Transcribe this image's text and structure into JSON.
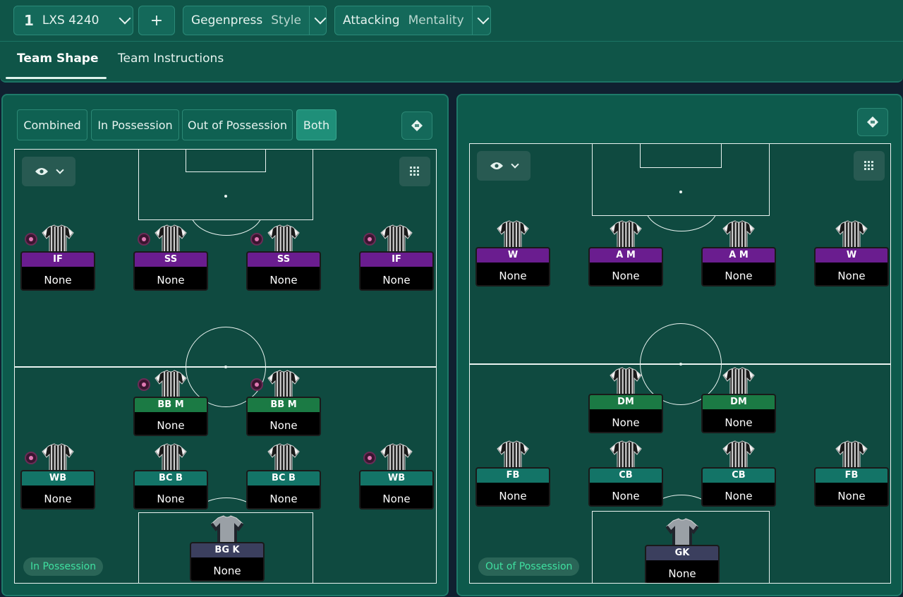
{
  "tactic": {
    "number": "1",
    "name": "LXS 4240"
  },
  "add_label": "+",
  "style": {
    "value": "Gegenpress",
    "label": "Style"
  },
  "mentality": {
    "value": "Attacking",
    "label": "Mentality"
  },
  "tabs": [
    "Team Shape",
    "Team Instructions"
  ],
  "view_toggles": [
    "Combined",
    "In Possession",
    "Out of Possession",
    "Both"
  ],
  "active_view": "Both",
  "left": {
    "legend": "In Possession",
    "players": [
      {
        "role": "IF",
        "duty": "None",
        "color": "purple",
        "token": true
      },
      {
        "role": "SS",
        "duty": "None",
        "color": "purple",
        "token": true
      },
      {
        "role": "SS",
        "duty": "None",
        "color": "purple",
        "token": true
      },
      {
        "role": "IF",
        "duty": "None",
        "color": "purple",
        "token": true
      },
      {
        "role": "BB M",
        "duty": "None",
        "color": "green",
        "token": true
      },
      {
        "role": "BB M",
        "duty": "None",
        "color": "green",
        "token": true
      },
      {
        "role": "WB",
        "duty": "None",
        "color": "teal",
        "token": true
      },
      {
        "role": "BC B",
        "duty": "None",
        "color": "teal",
        "token": false
      },
      {
        "role": "BC B",
        "duty": "None",
        "color": "teal",
        "token": false
      },
      {
        "role": "WB",
        "duty": "None",
        "color": "teal",
        "token": true
      },
      {
        "role": "BG K",
        "duty": "None",
        "color": "gk",
        "token": false
      }
    ]
  },
  "right": {
    "legend": "Out of Possession",
    "players": [
      {
        "role": "W",
        "duty": "None",
        "color": "purple"
      },
      {
        "role": "A M",
        "duty": "None",
        "color": "purple"
      },
      {
        "role": "A M",
        "duty": "None",
        "color": "purple"
      },
      {
        "role": "W",
        "duty": "None",
        "color": "purple"
      },
      {
        "role": "DM",
        "duty": "None",
        "color": "green"
      },
      {
        "role": "DM",
        "duty": "None",
        "color": "green"
      },
      {
        "role": "FB",
        "duty": "None",
        "color": "teal"
      },
      {
        "role": "CB",
        "duty": "None",
        "color": "teal"
      },
      {
        "role": "CB",
        "duty": "None",
        "color": "teal"
      },
      {
        "role": "FB",
        "duty": "None",
        "color": "teal"
      },
      {
        "role": "GK",
        "duty": "None",
        "color": "gk"
      }
    ]
  },
  "icons": [
    "chevron-down-icon",
    "eye-icon",
    "grid-icon",
    "tactic-board-icon"
  ]
}
